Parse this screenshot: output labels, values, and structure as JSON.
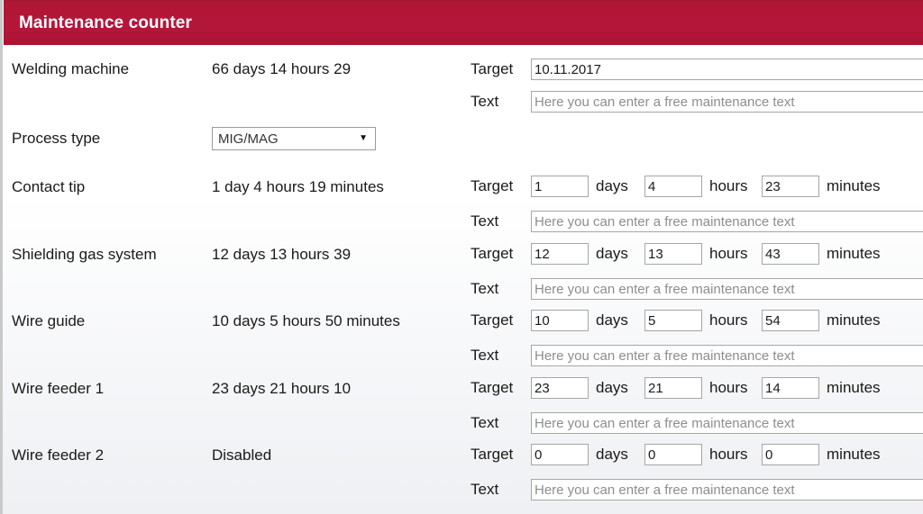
{
  "header": {
    "title": "Maintenance counter",
    "accent_color": "#b4163a",
    "text_color": "#ffffff"
  },
  "labels": {
    "target": "Target",
    "text": "Text",
    "days": "days",
    "hours": "hours",
    "minutes": "minutes"
  },
  "placeholders": {
    "free_text": "Here you can enter a free maintenance text"
  },
  "welding_machine": {
    "label": "Welding machine",
    "value": "66 days 14 hours 29",
    "target_date": "10.11.2017",
    "free_text": ""
  },
  "process_type": {
    "label": "Process type",
    "selected": "MIG/MAG",
    "caret": "chevron-down-icon"
  },
  "counters": [
    {
      "label": "Contact tip",
      "value": "1 day 4 hours 19 minutes",
      "days": "1",
      "hours": "4",
      "minutes": "23",
      "free_text": ""
    },
    {
      "label": "Shielding gas system",
      "value": "12 days 13 hours 39",
      "days": "12",
      "hours": "13",
      "minutes": "43",
      "free_text": ""
    },
    {
      "label": "Wire guide",
      "value": "10 days 5 hours 50 minutes",
      "days": "10",
      "hours": "5",
      "minutes": "54",
      "free_text": ""
    },
    {
      "label": "Wire feeder 1",
      "value": "23 days 21 hours 10",
      "days": "23",
      "hours": "21",
      "minutes": "14",
      "free_text": ""
    },
    {
      "label": "Wire feeder 2",
      "value": "Disabled",
      "days": "0",
      "hours": "0",
      "minutes": "0",
      "free_text": ""
    }
  ]
}
